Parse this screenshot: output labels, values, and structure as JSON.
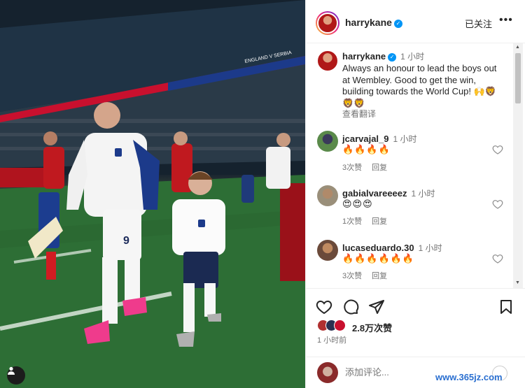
{
  "post": {
    "username": "harrykane",
    "follow_label": "已关注",
    "more_label": "•••",
    "caption_time": "1 小时",
    "caption": "Always an honour to lead the boys out at Wembley. Good to get the win, building towards the World Cup! 🙌🦁🦁🦁",
    "see_translation": "查看翻译",
    "stadium_banner_text": "ENGLAND V SERBIA"
  },
  "comments": [
    {
      "username": "jcarvajal_9",
      "time": "1 小时",
      "text": "🔥🔥🔥🔥",
      "likes": "3次赞",
      "reply": "回复"
    },
    {
      "username": "gabialvareeeez",
      "time": "1 小时",
      "text": "😍😍😍",
      "likes": "1次赞",
      "reply": "回复"
    },
    {
      "username": "lucaseduardo.30",
      "time": "1 小时",
      "text": "🔥🔥🔥🔥🔥🔥",
      "likes": "3次赞",
      "reply": "回复"
    }
  ],
  "actions": {
    "likes_count": "2.8万次赞",
    "posted_time": "1 小时前"
  },
  "add_comment": {
    "placeholder": "添加评论..."
  },
  "watermark": "www.365jz.com",
  "colors": {
    "verified": "#0095f6",
    "pitch": "#2b6b34",
    "link_gray": "#737373"
  },
  "icons": [
    "heart-icon",
    "comment-icon",
    "share-icon",
    "bookmark-icon",
    "verified-icon",
    "more-icon",
    "user-tag-icon",
    "emoji-icon"
  ]
}
